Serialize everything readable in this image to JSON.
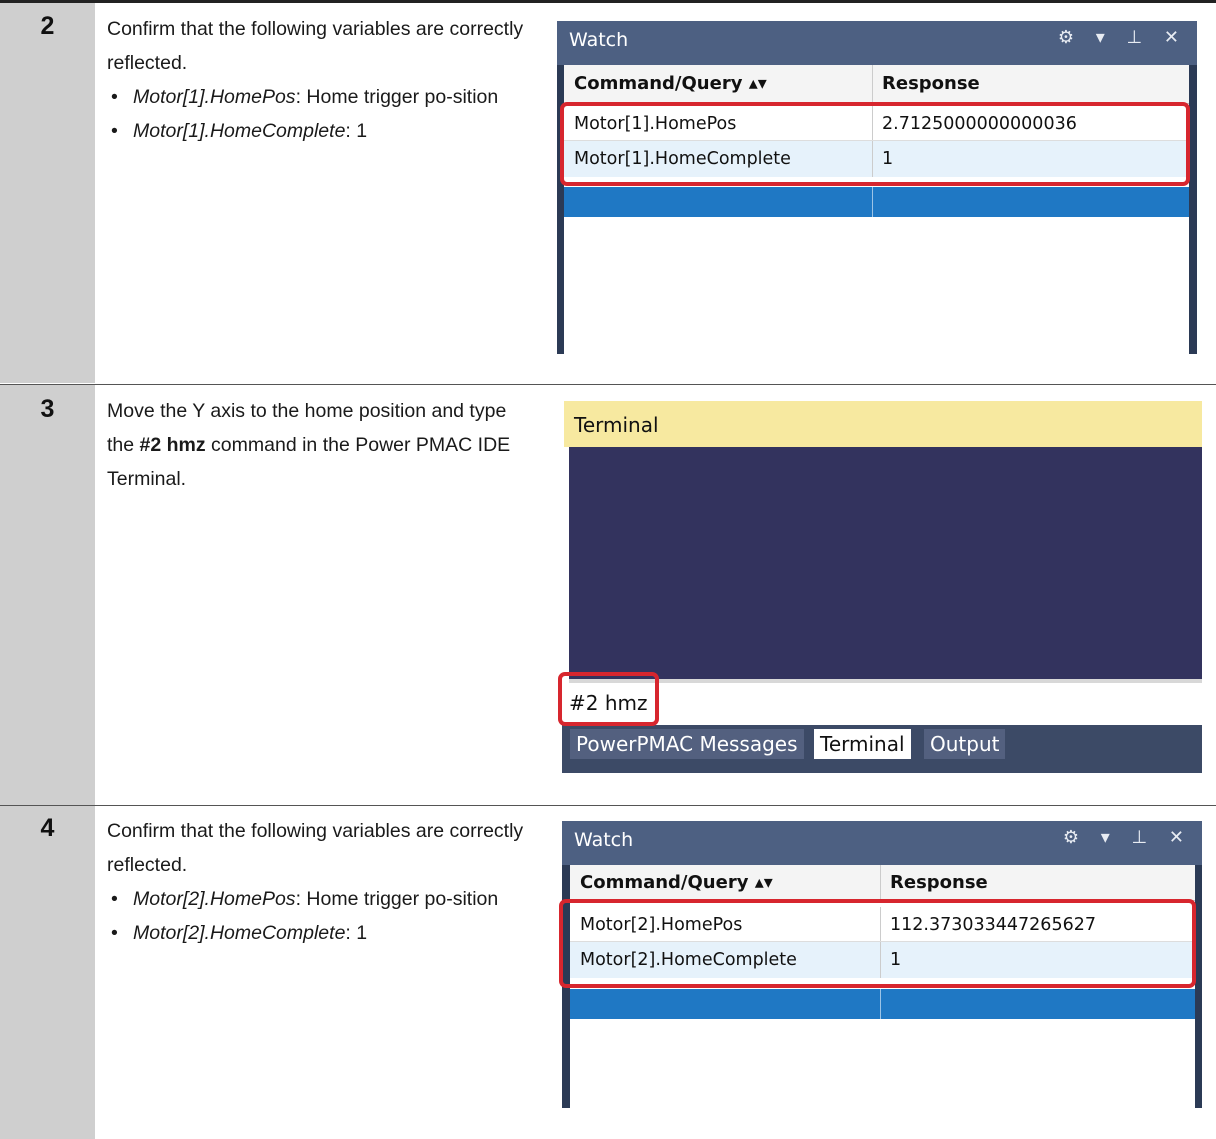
{
  "steps": [
    {
      "number": "2",
      "text": "Confirm that the following variables are correctly reflected.",
      "bullets": [
        {
          "var": "Motor[1].HomePos",
          "rest": ": Home trigger po-sition"
        },
        {
          "var": "Motor[1].HomeComplete",
          "rest": ": 1"
        }
      ],
      "watch": {
        "title": "Watch",
        "controls": "⚙ ▾ ⊥ ✕",
        "col_command": "Command/Query ▴▾",
        "col_response": "Response",
        "rows": [
          {
            "command": "Motor[1].HomePos",
            "response": "2.7125000000000036"
          },
          {
            "command": "Motor[1].HomeComplete",
            "response": "1"
          }
        ]
      }
    },
    {
      "number": "3",
      "text_pre": "Move the Y axis to the home position and type the ",
      "text_bold": "#2 hmz",
      "text_post": " command in the Power PMAC IDE Terminal.",
      "terminal": {
        "title": "Terminal",
        "input_value": "#2 hmz",
        "tabs": [
          "PowerPMAC Messages",
          "Terminal",
          "Output"
        ],
        "active_tab": "Terminal"
      }
    },
    {
      "number": "4",
      "text": "Confirm that the following variables are correctly reflected.",
      "bullets": [
        {
          "var": "Motor[2].HomePos",
          "rest": ": Home trigger po-sition"
        },
        {
          "var": "Motor[2].HomeComplete",
          "rest": ": 1"
        }
      ],
      "watch": {
        "title": "Watch",
        "controls": "⚙ ▾ ⊥ ✕",
        "col_command": "Command/Query ▴▾",
        "col_response": "Response",
        "rows": [
          {
            "command": "Motor[2].HomePos",
            "response": "112.373033447265627"
          },
          {
            "command": "Motor[2].HomeComplete",
            "response": "1"
          }
        ]
      }
    }
  ]
}
